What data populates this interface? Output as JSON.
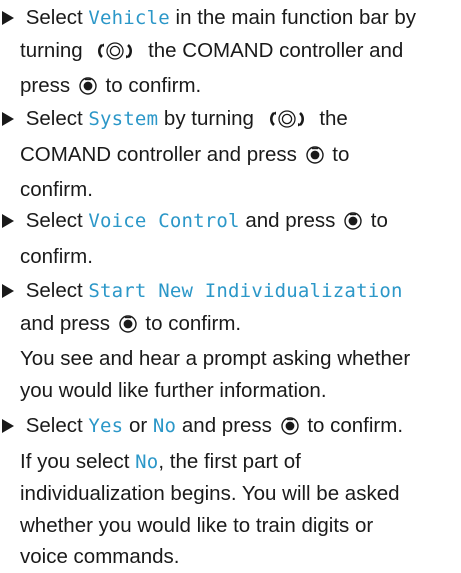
{
  "steps": [
    {
      "lines": [
        [
          " Select ",
          {
            "kw": "Vehicle"
          },
          " in the main function bar by"
        ],
        [
          "turning ",
          {
            "icon": "turn-controller-icon"
          },
          " the COMAND controller and"
        ],
        [
          "press ",
          {
            "icon": "press-icon"
          },
          " to confirm."
        ]
      ]
    },
    {
      "lines": [
        [
          " Select ",
          {
            "kw": "System"
          },
          " by turning ",
          {
            "icon": "turn-controller-icon"
          },
          " the"
        ],
        [
          "COMAND controller and press ",
          {
            "icon": "press-icon"
          },
          " to"
        ],
        [
          "confirm."
        ]
      ]
    },
    {
      "lines": [
        [
          " Select ",
          {
            "kw": "Voice Control"
          },
          " and press ",
          {
            "icon": "press-icon"
          },
          " to"
        ],
        [
          "confirm."
        ]
      ]
    },
    {
      "lines": [
        [
          " Select ",
          {
            "kw": "Start New Individualization"
          }
        ],
        [
          "and press ",
          {
            "icon": "press-icon"
          },
          " to confirm."
        ],
        [
          "You see and hear a prompt asking whether"
        ],
        [
          "you would like further information."
        ]
      ]
    },
    {
      "lines": [
        [
          " Select ",
          {
            "kw": "Yes"
          },
          " or ",
          {
            "kw": "No"
          },
          " and press ",
          {
            "icon": "press-icon"
          },
          " to confirm."
        ],
        [
          "If you select ",
          {
            "kw": "No"
          },
          ", the first part of"
        ],
        [
          "individualization begins. You will be asked"
        ],
        [
          "whether you would like to train digits or"
        ],
        [
          "voice commands."
        ]
      ]
    }
  ],
  "colors": {
    "text": "#1a1a1a",
    "keyword": "#2b97c8",
    "background": "#ffffff"
  }
}
